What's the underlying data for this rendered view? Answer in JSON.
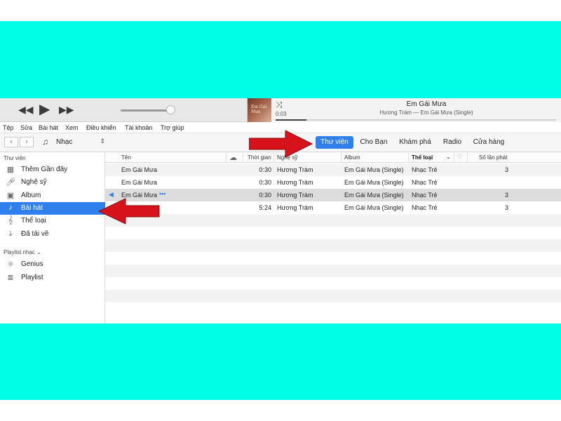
{
  "player": {
    "controls": [
      {
        "name": "rewind-button",
        "glyph": "◀◀"
      },
      {
        "name": "play-button",
        "glyph": "▶"
      },
      {
        "name": "fast-forward-button",
        "glyph": "▶▶"
      }
    ],
    "volume_level": 0.9
  },
  "now_playing": {
    "artwork_text": "Em Gái Mưa",
    "shuffle_icon": "shuffle-icon",
    "elapsed": "0:03",
    "title": "Em Gái Mưa",
    "subtitle": "Hương Tràm — Em Gái Mưa (Single)",
    "progress": 0.11
  },
  "menu": [
    "Tệp",
    "Sửa",
    "Bài hát",
    "Xem",
    "Điều khiển",
    "Tài khoản",
    "Trợ giúp"
  ],
  "toolbar": {
    "back": "‹",
    "forward": "›",
    "media_label": "Nhạc",
    "tabs": [
      {
        "label": "Thư viện",
        "active": true
      },
      {
        "label": "Cho Bạn",
        "active": false
      },
      {
        "label": "Khám phá",
        "active": false
      },
      {
        "label": "Radio",
        "active": false
      },
      {
        "label": "Cửa hàng",
        "active": false
      }
    ]
  },
  "sidebar": {
    "library_header": "Thư viện",
    "library_items": [
      {
        "label": "Thêm Gần đây",
        "icon": "calendar-icon",
        "selected": false
      },
      {
        "label": "Nghệ sỹ",
        "icon": "microphone-icon",
        "selected": false
      },
      {
        "label": "Album",
        "icon": "album-icon",
        "selected": false
      },
      {
        "label": "Bài hát",
        "icon": "music-note-icon",
        "selected": true
      },
      {
        "label": "Thể loại",
        "icon": "genre-icon",
        "selected": false
      },
      {
        "label": "Đã tải về",
        "icon": "download-icon",
        "selected": false
      }
    ],
    "playlist_header": "Playlist nhạc ⌄",
    "playlist_items": [
      {
        "label": "Genius",
        "icon": "genius-icon"
      },
      {
        "label": "Playlist",
        "icon": "playlist-icon"
      }
    ]
  },
  "table": {
    "headers": {
      "name": "Tên",
      "cloud": "cloud-icon",
      "time": "Thời gian",
      "artist": "Nghệ sỹ",
      "album": "Album",
      "genre": "Thể loại",
      "plays": "Số lần phát"
    },
    "rows": [
      {
        "name": "Em Gái Mưa",
        "time": "0:30",
        "artist": "Hương Tràm",
        "album": "Em Gái Mưa (Single)",
        "genre": "Nhạc Trẻ",
        "plays": "3",
        "playing": false
      },
      {
        "name": "Em Gái Mưa",
        "time": "0:30",
        "artist": "Hương Tràm",
        "album": "Em Gái Mưa (Single)",
        "genre": "Nhạc Trẻ",
        "plays": "",
        "playing": false
      },
      {
        "name": "Em Gái Mưa",
        "time": "0:30",
        "artist": "Hương Tràm",
        "album": "Em Gái Mưa (Single)",
        "genre": "Nhạc Trẻ",
        "plays": "3",
        "playing": true
      },
      {
        "name": "Em Gái Mưa",
        "time": "5:24",
        "artist": "Hương Tràm",
        "album": "Em Gái Mưa (Single)",
        "genre": "Nhạc Trẻ",
        "plays": "3",
        "playing": false
      }
    ],
    "empty_rows": 8
  },
  "colors": {
    "band": "#00fde6",
    "accent": "#2f80ed",
    "arrow": "#d8121a"
  }
}
